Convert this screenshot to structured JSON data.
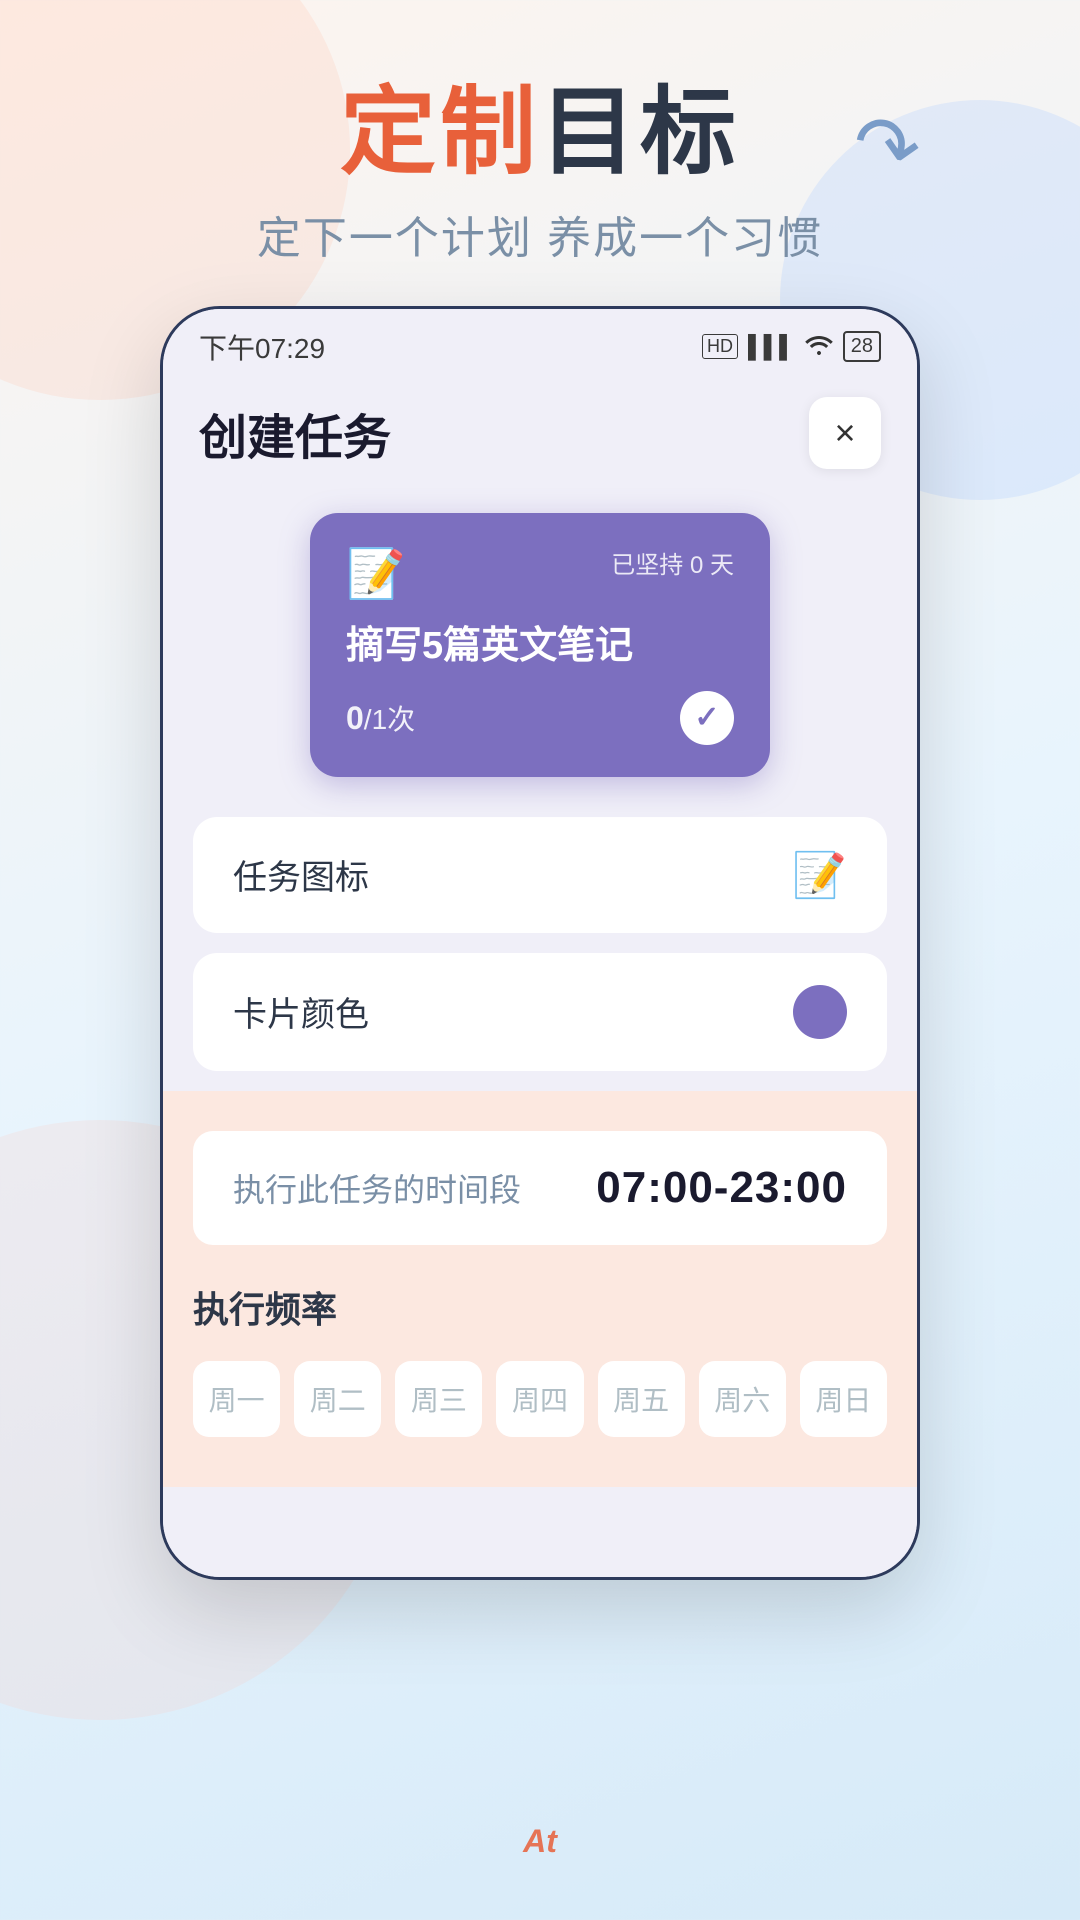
{
  "background": {
    "gradient_start": "#fdf4ee",
    "gradient_end": "#d6eaf8"
  },
  "hero": {
    "title_red": "定制",
    "title_dark": "目标",
    "subtitle": "定下一个计划 养成一个习惯",
    "arrow": "↷"
  },
  "status_bar": {
    "time": "下午07:29",
    "hd": "HD",
    "battery": "28"
  },
  "header": {
    "title": "创建任务",
    "close_label": "×"
  },
  "task_card": {
    "icon": "📝",
    "streak_label": "已坚持",
    "streak_value": "0",
    "streak_unit": "天",
    "name": "摘写5篇英文笔记",
    "progress_current": "0",
    "progress_total": "1",
    "progress_unit": "次"
  },
  "settings": {
    "icon_row": {
      "label": "任务图标",
      "icon": "📝"
    },
    "color_row": {
      "label": "卡片颜色",
      "color": "#7c6fbf"
    }
  },
  "bottom": {
    "time_row": {
      "label": "执行此任务的时间段",
      "value": "07:00-23:00"
    },
    "freq_title": "执行频率",
    "weekdays": [
      "周一",
      "周二",
      "周三",
      "周四",
      "周五",
      "周六",
      "周日"
    ]
  },
  "bottom_nav": {
    "at_label": "At"
  }
}
